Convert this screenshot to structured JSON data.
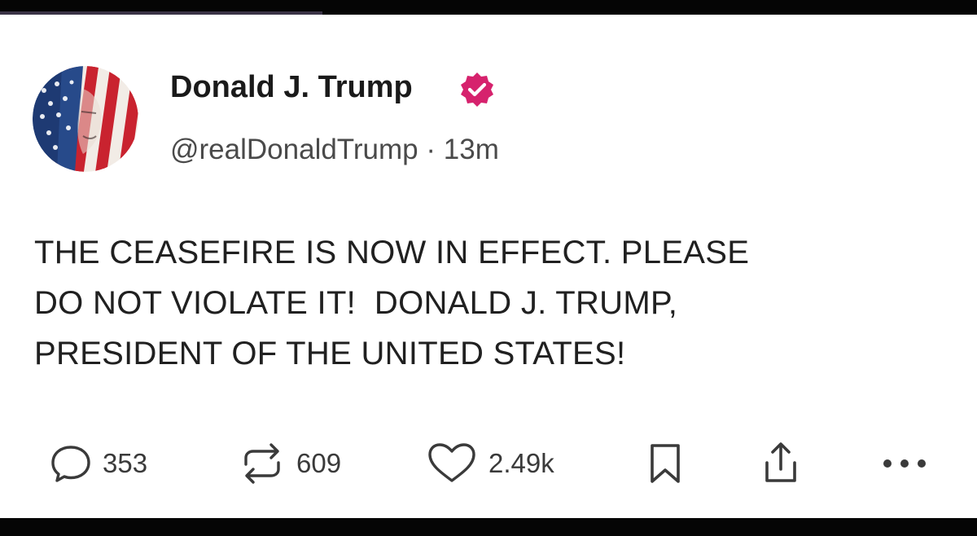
{
  "post": {
    "author": {
      "display_name": "Donald J. Trump",
      "handle": "@realDonaldTrump",
      "verified_icon": "verified-badge-icon"
    },
    "separator": "·",
    "time_ago": "13m",
    "text_lines": [
      "THE CEASEFIRE IS NOW IN EFFECT. PLEASE",
      "DO NOT VIOLATE IT!  DONALD J. TRUMP,",
      "PRESIDENT OF THE UNITED STATES!"
    ],
    "actions": {
      "replies": "353",
      "retruths": "609",
      "likes": "2.49k"
    }
  },
  "colors": {
    "verified_badge": "#d6226d",
    "text": "#202020",
    "muted": "#4a4a4a",
    "icon": "#3a3a3a"
  },
  "video_progress_fraction": 0.33
}
